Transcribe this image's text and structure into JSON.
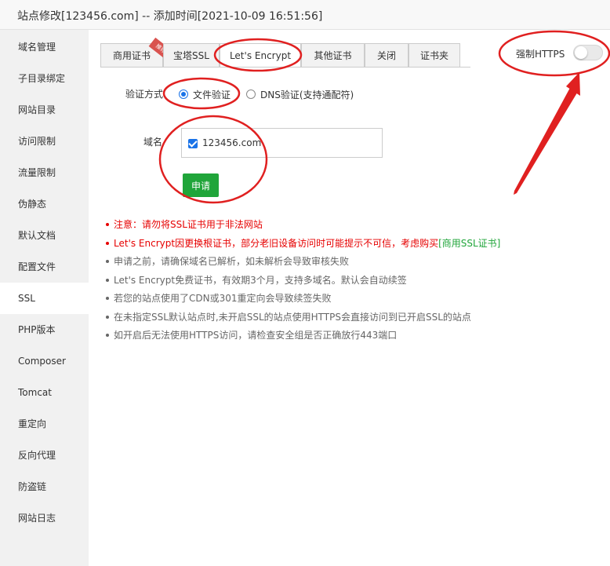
{
  "window": {
    "title": "站点修改[123456.com] -- 添加时间[2021-10-09 16:51:56]"
  },
  "sidebar": {
    "items": [
      {
        "label": "域名管理"
      },
      {
        "label": "子目录绑定"
      },
      {
        "label": "网站目录"
      },
      {
        "label": "访问限制"
      },
      {
        "label": "流量限制"
      },
      {
        "label": "伪静态"
      },
      {
        "label": "默认文档"
      },
      {
        "label": "配置文件"
      },
      {
        "label": "SSL"
      },
      {
        "label": "PHP版本"
      },
      {
        "label": "Composer"
      },
      {
        "label": "Tomcat"
      },
      {
        "label": "重定向"
      },
      {
        "label": "反向代理"
      },
      {
        "label": "防盗链"
      },
      {
        "label": "网站日志"
      }
    ],
    "active": "SSL"
  },
  "tabs": [
    {
      "label": "商用证书",
      "badge": "推荐"
    },
    {
      "label": "宝塔SSL"
    },
    {
      "label": "Let's Encrypt"
    },
    {
      "label": "其他证书"
    },
    {
      "label": "关闭"
    },
    {
      "label": "证书夹"
    }
  ],
  "active_tab": "Let's Encrypt",
  "force_https": {
    "label": "强制HTTPS",
    "enabled": false
  },
  "verify": {
    "label": "验证方式",
    "options": [
      {
        "label": "文件验证",
        "checked": true
      },
      {
        "label": "DNS验证(支持通配符)",
        "checked": false
      }
    ]
  },
  "domain": {
    "label": "域名",
    "items": [
      {
        "name": "123456.com",
        "checked": true
      }
    ]
  },
  "apply_button": "申请",
  "notes": {
    "n1": "注意：请勿将SSL证书用于非法网站",
    "n2_text": "Let's Encrypt因更换根证书，部分老旧设备访问时可能提示不可信，考虑购买",
    "n2_link": "[商用SSL证书]",
    "n3": "申请之前，请确保域名已解析，如未解析会导致审核失败",
    "n4": "Let's Encrypt免费证书，有效期3个月，支持多域名。默认会自动续签",
    "n5": "若您的站点使用了CDN或301重定向会导致续签失败",
    "n6": "在未指定SSL默认站点时,未开启SSL的站点使用HTTPS会直接访问到已开启SSL的站点",
    "n7": "如开启后无法使用HTTPS访问，请检查安全组是否正确放行443端口"
  },
  "colors": {
    "accent_green": "#20a53a",
    "warning_red": "#e60000",
    "annotation_red": "#e02020",
    "radio_blue": "#1a73e8"
  }
}
